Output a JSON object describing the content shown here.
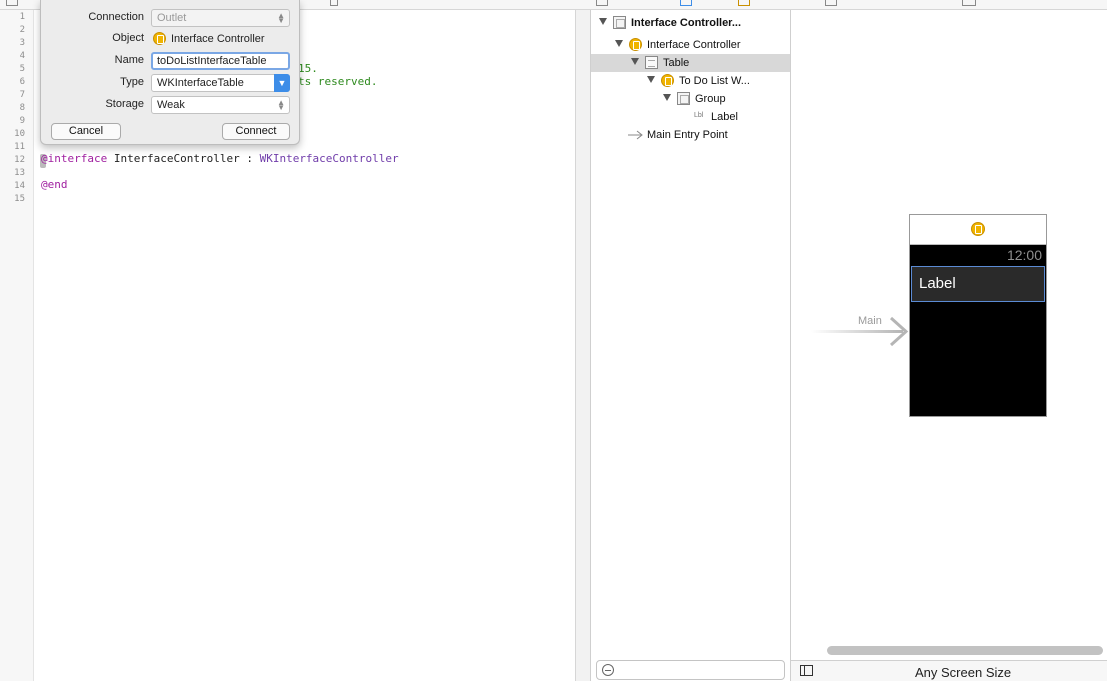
{
  "editor": {
    "line_numbers": [
      "1",
      "2",
      "3",
      "4",
      "5",
      "6",
      "7",
      "8",
      "9",
      "10",
      "11",
      "12",
      "13",
      "14",
      "15"
    ],
    "line5_fragment": "15.",
    "line6_fragment": "ts reserved.",
    "line12": {
      "keyword": "@interface",
      "name": "InterfaceController",
      "colon": ":",
      "superclass": "WKInterfaceController"
    },
    "line14": "@end"
  },
  "popover": {
    "connection_label": "Connection",
    "connection_value": "Outlet",
    "object_label": "Object",
    "object_value": "Interface Controller",
    "name_label": "Name",
    "name_value": "toDoListInterfaceTable",
    "type_label": "Type",
    "type_value": "WKInterfaceTable",
    "storage_label": "Storage",
    "storage_value": "Weak",
    "cancel_label": "Cancel",
    "connect_label": "Connect"
  },
  "outline": {
    "scene": "Interface Controller...",
    "controller": "Interface Controller",
    "table": "Table",
    "row": "To Do List W...",
    "group": "Group",
    "label_badge": "Lbl",
    "label": "Label",
    "entry": "Main Entry Point"
  },
  "canvas": {
    "time": "12:00",
    "row_label": "Label",
    "entry_label": "Main",
    "screen_size": "Any Screen Size"
  }
}
